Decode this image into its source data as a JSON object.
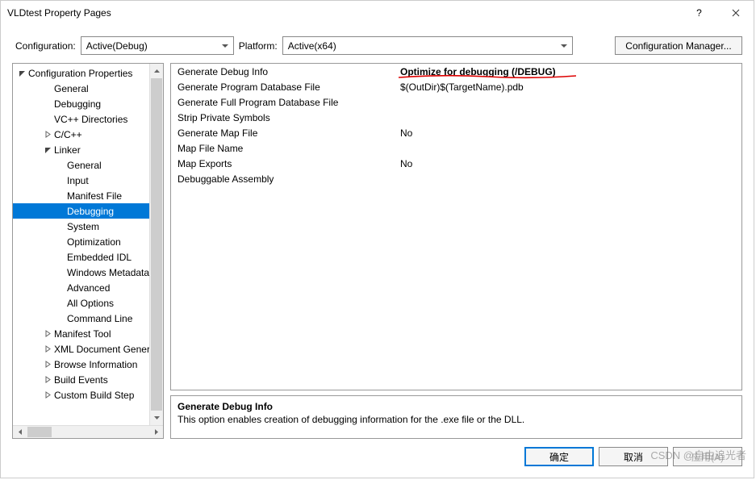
{
  "window": {
    "title": "VLDtest Property Pages"
  },
  "toolbar": {
    "configuration_label": "Configuration:",
    "configuration_value": "Active(Debug)",
    "platform_label": "Platform:",
    "platform_value": "Active(x64)",
    "config_manager_label": "Configuration Manager..."
  },
  "tree": {
    "root_label": "Configuration Properties",
    "items": [
      {
        "label": "General",
        "indent": 2
      },
      {
        "label": "Debugging",
        "indent": 2
      },
      {
        "label": "VC++ Directories",
        "indent": 2
      },
      {
        "label": "C/C++",
        "indent": 2,
        "twisty": "closed"
      },
      {
        "label": "Linker",
        "indent": 2,
        "twisty": "open",
        "children": [
          {
            "label": "General",
            "indent": 3
          },
          {
            "label": "Input",
            "indent": 3
          },
          {
            "label": "Manifest File",
            "indent": 3
          },
          {
            "label": "Debugging",
            "indent": 3,
            "selected": true
          },
          {
            "label": "System",
            "indent": 3
          },
          {
            "label": "Optimization",
            "indent": 3
          },
          {
            "label": "Embedded IDL",
            "indent": 3
          },
          {
            "label": "Windows Metadata",
            "indent": 3
          },
          {
            "label": "Advanced",
            "indent": 3
          },
          {
            "label": "All Options",
            "indent": 3
          },
          {
            "label": "Command Line",
            "indent": 3
          }
        ]
      },
      {
        "label": "Manifest Tool",
        "indent": 2,
        "twisty": "closed"
      },
      {
        "label": "XML Document Generator",
        "indent": 2,
        "twisty": "closed"
      },
      {
        "label": "Browse Information",
        "indent": 2,
        "twisty": "closed"
      },
      {
        "label": "Build Events",
        "indent": 2,
        "twisty": "closed"
      },
      {
        "label": "Custom Build Step",
        "indent": 2,
        "twisty": "closed"
      }
    ]
  },
  "grid": {
    "rows": [
      {
        "key": "Generate Debug Info",
        "value": "Optimize for debugging (/DEBUG)",
        "highlighted": true
      },
      {
        "key": "Generate Program Database File",
        "value": "$(OutDir)$(TargetName).pdb"
      },
      {
        "key": "Generate Full Program Database File",
        "value": ""
      },
      {
        "key": "Strip Private Symbols",
        "value": ""
      },
      {
        "key": "Generate Map File",
        "value": "No"
      },
      {
        "key": "Map File Name",
        "value": ""
      },
      {
        "key": "Map Exports",
        "value": "No"
      },
      {
        "key": "Debuggable Assembly",
        "value": ""
      }
    ]
  },
  "description": {
    "title": "Generate Debug Info",
    "text": "This option enables creation of debugging information for the .exe file or the DLL."
  },
  "buttons": {
    "ok": "确定",
    "cancel": "取消",
    "apply": "应用(A)"
  },
  "watermark": "CSDN @自由追光者"
}
